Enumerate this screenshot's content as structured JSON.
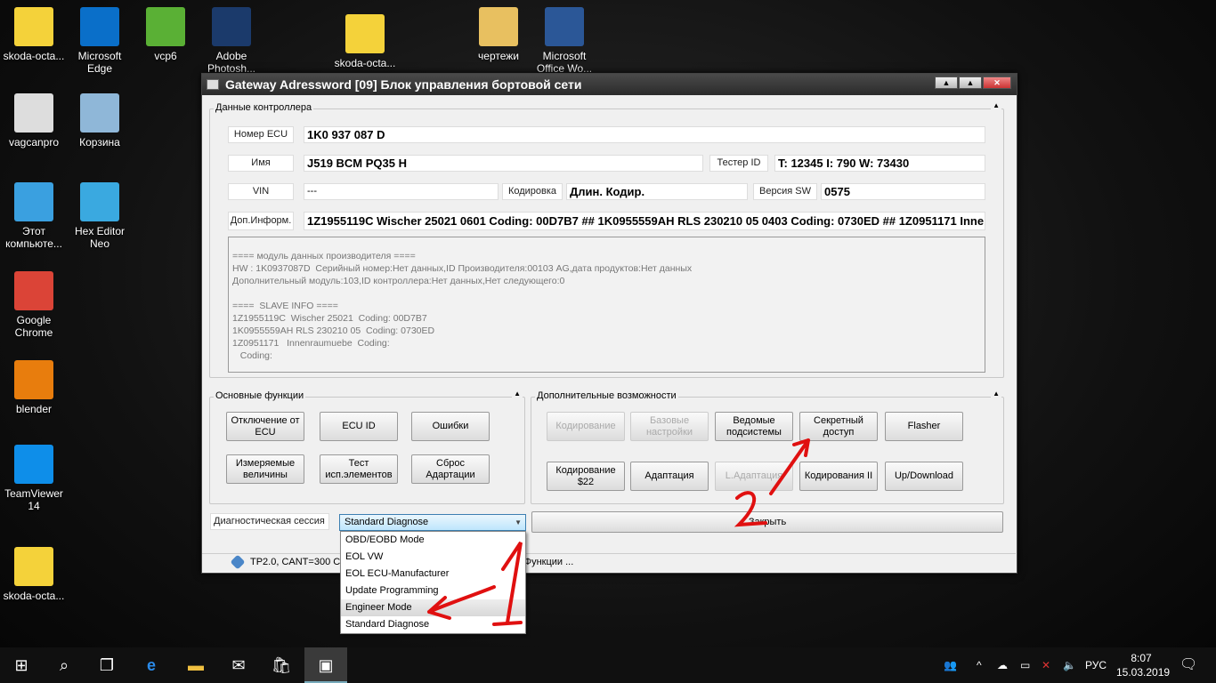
{
  "desktop": {
    "icons": [
      {
        "label": "skoda-octa...",
        "color": "#f4d23a"
      },
      {
        "label": "Microsoft Edge",
        "color": "#0a6fc9"
      },
      {
        "label": "vcp6",
        "color": "#5ab035"
      },
      {
        "label": "Adobe Photosh...",
        "color": "#1b3a6b"
      },
      {
        "label": "skoda-octa...",
        "color": "#f4d23a"
      },
      {
        "label": "чертежи",
        "color": "#e8c060"
      },
      {
        "label": "Microsoft Office Wo...",
        "color": "#2b5797"
      },
      {
        "label": "vagcanpro",
        "color": "#ddd"
      },
      {
        "label": "Корзина",
        "color": "#8fb7d8"
      },
      {
        "label": "Этот компьюте...",
        "color": "#3aa0e0"
      },
      {
        "label": "Hex Editor Neo",
        "color": "#3aa9e0"
      },
      {
        "label": "Google Chrome",
        "color": "#db4437"
      },
      {
        "label": "blender",
        "color": "#e87d0d"
      },
      {
        "label": "TeamViewer 14",
        "color": "#0e8ee9"
      },
      {
        "label": "skoda-octa...",
        "color": "#f4d23a"
      }
    ]
  },
  "window": {
    "title": "Gateway Adressword [09] Блок управления бортовой сети",
    "buttons": [
      "▲",
      "▲",
      "✕"
    ]
  },
  "controller": {
    "group_label": "Данные контроллера",
    "ecu_label": "Номер ECU",
    "ecu_value": "1K0 937 087 D",
    "name_label": "Имя",
    "name_value": "J519 BCM PQ35  H",
    "tester_label": "Тестер ID",
    "tester_value": "T: 12345 I: 790 W: 73430",
    "vin_label": "VIN",
    "vin_value": "---",
    "coding_label": "Кодировка",
    "coding_value": "Длин. Кодир.",
    "sw_label": "Версия SW",
    "sw_value": "0575",
    "info_label": "Доп.Информ.",
    "info_value": "1Z1955119C  Wischer 25021 0601 Coding: 00D7B7 ## 1K0955559AH RLS 230210 05 0403 Coding: 0730ED ## 1Z0951171   Inne",
    "memo": "==== модуль данных производителя ====\nHW : 1K0937087D  Серийный номер:Нет данных,ID Производителя:00103 AG,дата продуктов:Нет данных\nДополнительный модуль:103,ID контроллера:Нет данных,Нет следующего:0\n\n====  SLAVE INFO ====\n1Z1955119C  Wischer 25021  Coding: 00D7B7\n1K0955559AH RLS 230210 05  Coding: 0730ED\n1Z0951171   Innenraumuebe  Coding:\n   Coding:"
  },
  "basic": {
    "group_label": "Основные функции",
    "buttons": [
      "Отключение от ECU",
      "ECU ID",
      "Ошибки",
      "Измеряемые величины",
      "Тест исп.элементов",
      "Сброс Адартации"
    ]
  },
  "extra": {
    "group_label": "Дополнительные возможности",
    "buttons": [
      "Кодирование",
      "Базовые настройки",
      "Ведомые подсистемы",
      "Секретный доступ",
      "Flasher",
      "Кодирование $22",
      "Адаптация",
      "L.Адаптация",
      "Кодирования II",
      "Up/Download"
    ]
  },
  "session": {
    "label": "Диагностическая сессия",
    "selected": "Standard Diagnose",
    "options": [
      "OBD/EOBD Mode",
      "EOL VW",
      "EOL ECU-Manufacturer",
      "Update Programming",
      "Engineer Mode",
      "Standard Diagnose"
    ],
    "highlighted": "Engineer Mode"
  },
  "close_label": "Закрыть",
  "status": "TP2.0, CANT=300 CAN соединение установлено. Выберите Функции ...",
  "annotations": {
    "one": "1",
    "two": "2",
    "color": "#e01010"
  },
  "taskbar": {
    "lang": "РУС",
    "time": "8:07",
    "date": "15.03.2019"
  }
}
